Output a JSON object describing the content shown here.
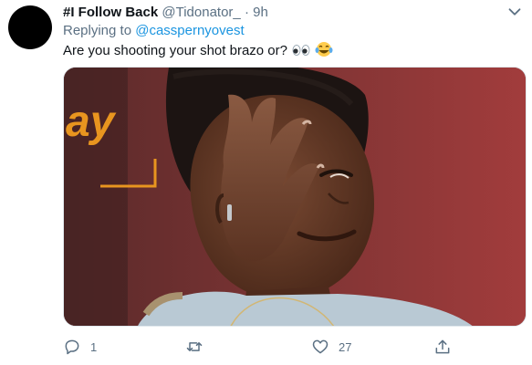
{
  "tweet": {
    "display_name": "#I Follow Back",
    "handle": "@Tidonator_",
    "separator": "·",
    "time": "9h",
    "replying_to_prefix": "Replying to",
    "replying_to_handle": "@casspernyovest",
    "text": "Are you shooting your shot brazo or?",
    "emoji_icons": [
      "eyes-icon",
      "tears-of-joy-icon"
    ],
    "media": {
      "sign_text": "ay",
      "colors": {
        "background": "#8b3434",
        "skin": "#5b3322",
        "shirt": "#b9c9d4",
        "headwrap": "#1c1412"
      }
    }
  },
  "actions": {
    "reply_count": "1",
    "retweet_count": "",
    "like_count": "27"
  },
  "colors": {
    "text_primary": "#0f1419",
    "text_secondary": "#5b7083",
    "link": "#1b95e0",
    "icon": "#5b7083"
  }
}
